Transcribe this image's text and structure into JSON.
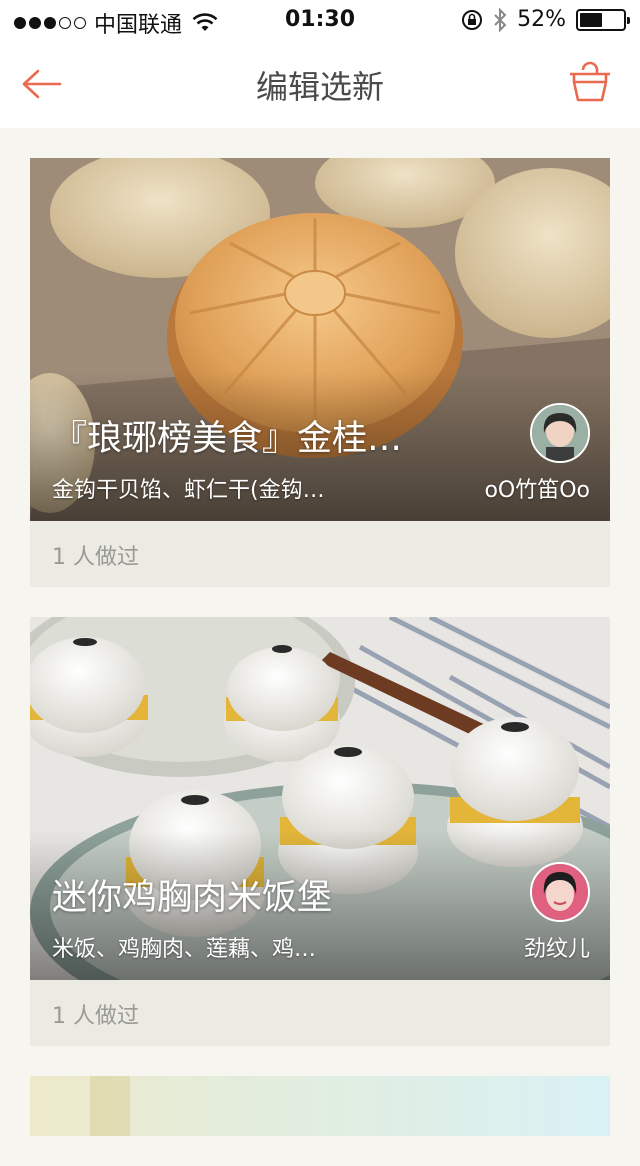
{
  "status_bar": {
    "carrier": "中国联通",
    "time": "01:30",
    "battery_percent": "52%",
    "battery_level": 0.52,
    "signal_bars_filled": 3
  },
  "nav": {
    "title": "编辑选新",
    "back_icon": "back-arrow-icon",
    "basket_icon": "basket-icon",
    "accent_color": "#e96a4e"
  },
  "recipes": [
    {
      "title": "『琅琊榜美食』金桂…",
      "ingredients": "金钩干贝馅、虾仁干(金钩…",
      "author": "oO竹笛Oo",
      "made_count": "1 人做过"
    },
    {
      "title": "迷你鸡胸肉米饭堡",
      "ingredients": "米饭、鸡胸肉、莲藕、鸡…",
      "author": "劲纹儿",
      "made_count": "1 人做过"
    }
  ]
}
